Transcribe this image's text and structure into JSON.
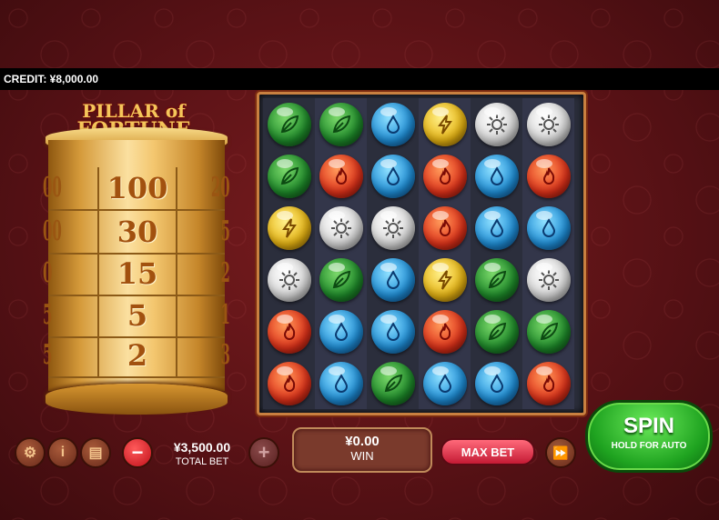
{
  "header": {
    "credit": "CREDIT: ¥8,000.00"
  },
  "logo": {
    "line1": "PILLAR of",
    "line2": "FORTUNE"
  },
  "pillar": {
    "rows": [
      {
        "value": "100",
        "left": "00",
        "right": "20"
      },
      {
        "value": "30",
        "left": "00",
        "right": "5"
      },
      {
        "value": "15",
        "left": "0",
        "right": "2"
      },
      {
        "value": "5",
        "left": "5",
        "right": "1"
      },
      {
        "value": "2",
        "left": "5",
        "right": "3"
      }
    ]
  },
  "board": {
    "grid": [
      [
        "earth",
        "earth",
        "water",
        "lightning",
        "sun",
        "sun"
      ],
      [
        "earth",
        "fire",
        "water",
        "fire",
        "water",
        "fire"
      ],
      [
        "lightning",
        "sun",
        "sun",
        "fire",
        "water",
        "water"
      ],
      [
        "sun",
        "earth",
        "water",
        "lightning",
        "earth",
        "sun"
      ],
      [
        "fire",
        "water",
        "water",
        "fire",
        "earth",
        "earth"
      ],
      [
        "fire",
        "water",
        "earth",
        "water",
        "water",
        "fire"
      ]
    ]
  },
  "controls": {
    "settings_icon": "gear-icon",
    "info_icon": "info-icon",
    "paytable_icon": "clipboard-icon",
    "minus_label": "−",
    "plus_label": "+",
    "total_bet_amount": "¥3,500.00",
    "total_bet_label": "TOTAL BET",
    "win_amount": "¥0.00",
    "win_label": "WIN",
    "max_bet_label": "MAX BET",
    "fast_forward_label": "⏩",
    "spin_label": "SPIN",
    "spin_sub_label": "HOLD FOR AUTO"
  },
  "colors": {
    "background": "#5a1216",
    "spin_green": "#1fa320",
    "max_bet_red": "#c41a34",
    "board_frame": "#c98040"
  }
}
